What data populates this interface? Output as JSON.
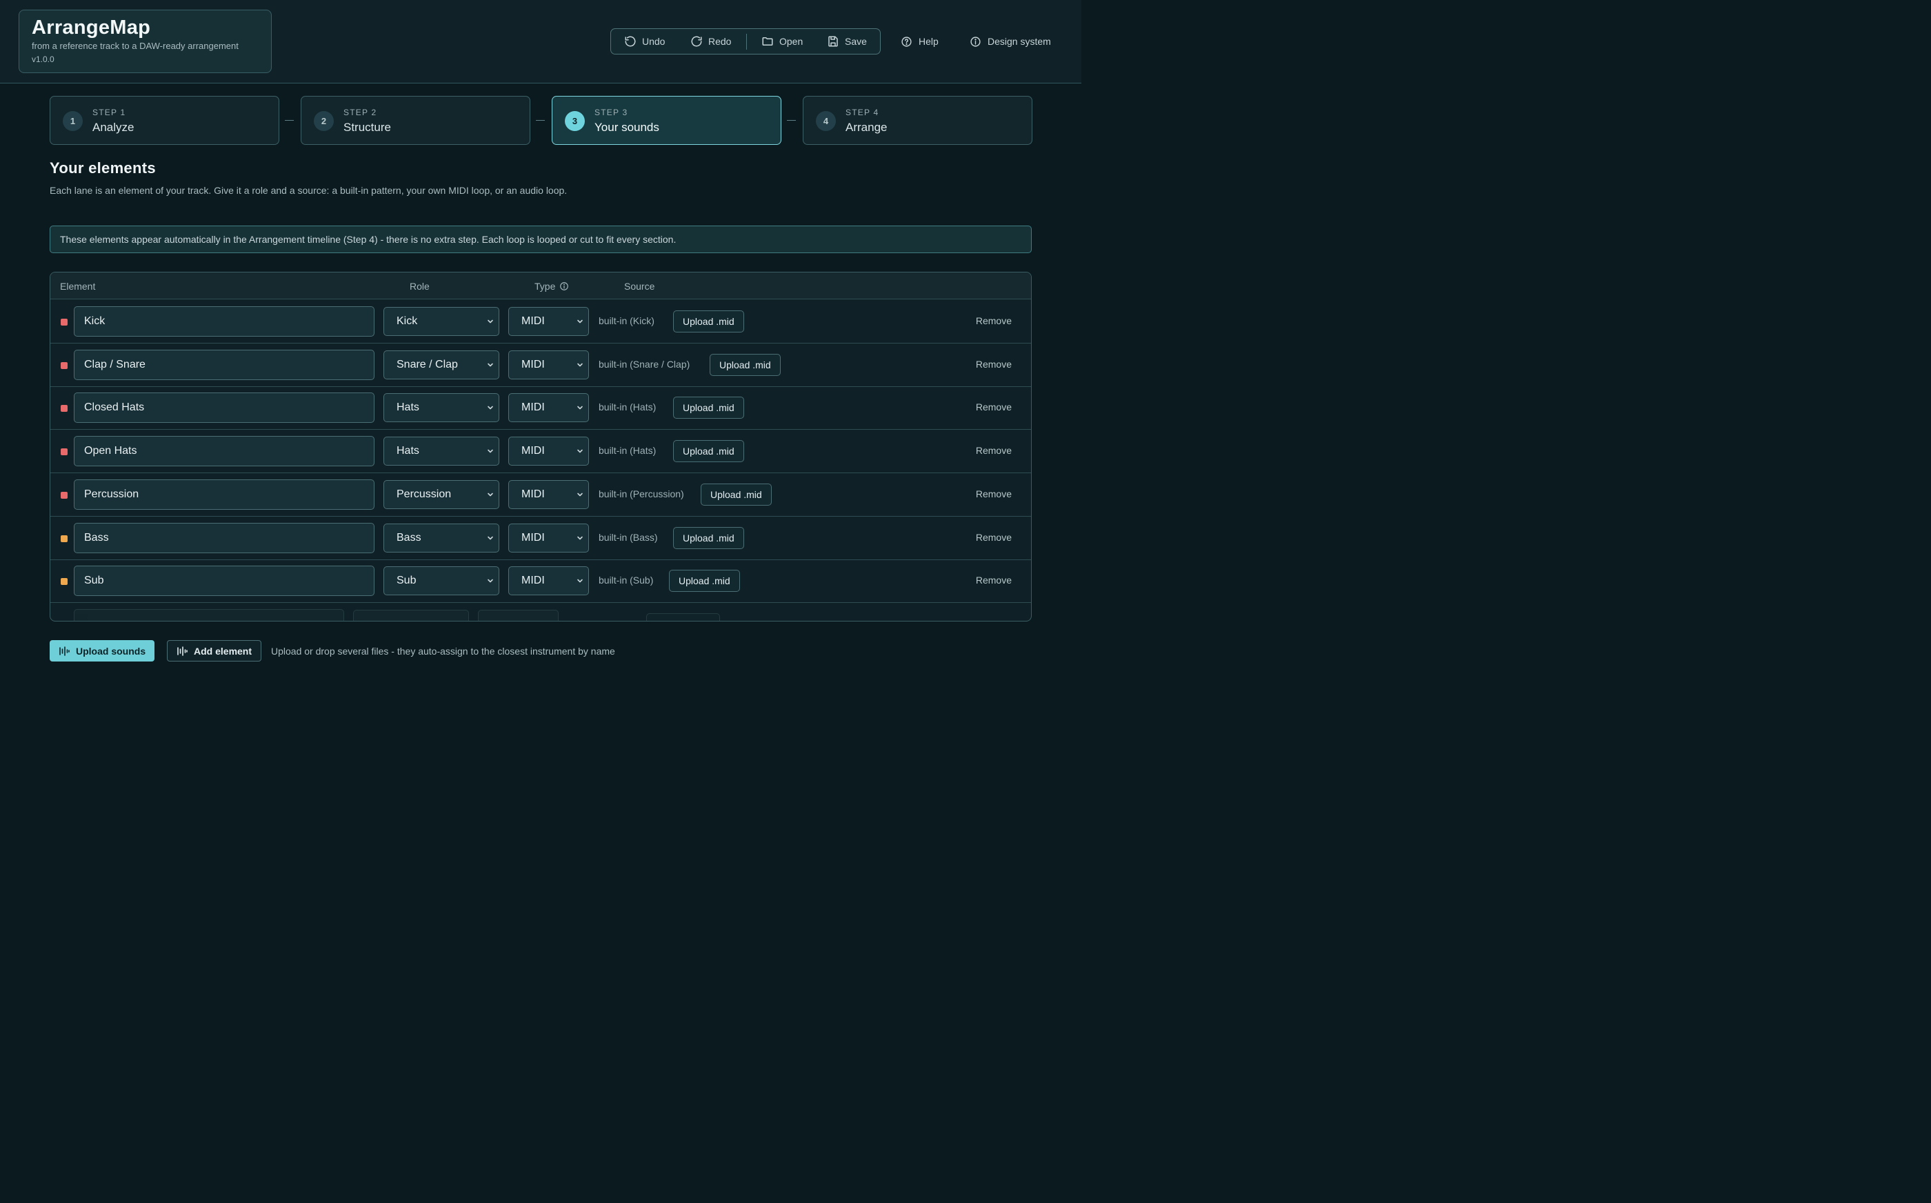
{
  "app": {
    "title": "ArrangeMap",
    "subtitle": "from a reference track to a DAW-ready arrangement",
    "version": "v1.0.0"
  },
  "toolbar": {
    "undo": "Undo",
    "redo": "Redo",
    "open": "Open",
    "save": "Save",
    "help": "Help",
    "design_system": "Design system"
  },
  "steps": [
    {
      "num": "1",
      "label": "STEP 1",
      "title": "Analyze",
      "active": false
    },
    {
      "num": "2",
      "label": "STEP 2",
      "title": "Structure",
      "active": false
    },
    {
      "num": "3",
      "label": "STEP 3",
      "title": "Your sounds",
      "active": true
    },
    {
      "num": "4",
      "label": "STEP 4",
      "title": "Arrange",
      "active": false
    }
  ],
  "section": {
    "title": "Your elements",
    "description": "Each lane is an element of your track. Give it a role and a source: a built-in pattern, your own MIDI loop, or an audio loop.",
    "notice": "These elements appear automatically in the Arrangement timeline (Step 4) - there is no extra step. Each loop is looped or cut to fit every section."
  },
  "table": {
    "headers": {
      "element": "Element",
      "role": "Role",
      "type": "Type",
      "source": "Source"
    },
    "upload_label": "Upload .mid",
    "remove_label": "Remove",
    "rows": [
      {
        "name": "Kick",
        "role": "Kick",
        "type": "MIDI",
        "source": "built-in (Kick)",
        "color": "#e86a6a"
      },
      {
        "name": "Clap / Snare",
        "role": "Snare / Clap",
        "type": "MIDI",
        "source": "built-in (Snare / Clap)",
        "color": "#e86a6a"
      },
      {
        "name": "Closed Hats",
        "role": "Hats",
        "type": "MIDI",
        "source": "built-in (Hats)",
        "color": "#e86a6a"
      },
      {
        "name": "Open Hats",
        "role": "Hats",
        "type": "MIDI",
        "source": "built-in (Hats)",
        "color": "#e86a6a"
      },
      {
        "name": "Percussion",
        "role": "Percussion",
        "type": "MIDI",
        "source": "built-in (Percussion)",
        "color": "#e86a6a"
      },
      {
        "name": "Bass",
        "role": "Bass",
        "type": "MIDI",
        "source": "built-in (Bass)",
        "color": "#f0a84e"
      },
      {
        "name": "Sub",
        "role": "Sub",
        "type": "MIDI",
        "source": "built-in (Sub)",
        "color": "#f0a84e"
      }
    ]
  },
  "footer": {
    "upload_sounds": "Upload sounds",
    "add_element": "Add element",
    "hint": "Upload or drop several files - they auto-assign to the closest instrument by name"
  }
}
